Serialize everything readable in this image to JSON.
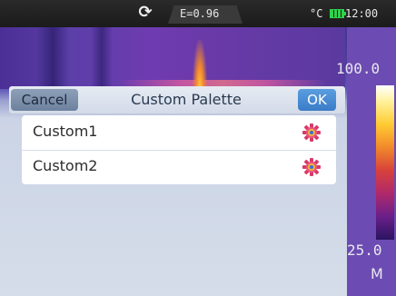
{
  "status": {
    "refresh_icon": "refresh-icon",
    "emissivity": "E=0.96",
    "unit": "°C",
    "battery_icon": "battery-icon",
    "time": "12:00"
  },
  "scale": {
    "max": "100.0",
    "min": "25.0",
    "mode": "M"
  },
  "dialog": {
    "cancel_label": "Cancel",
    "title": "Custom Palette",
    "ok_label": "OK",
    "items": [
      {
        "label": "Custom1",
        "icon": "gear-icon"
      },
      {
        "label": "Custom2",
        "icon": "gear-icon"
      }
    ]
  },
  "colors": {
    "ok_button": "#3a7cc8",
    "cancel_button": "#6d819e",
    "header_bg": "#d3dbe8",
    "list_bg": "#ffffff"
  }
}
